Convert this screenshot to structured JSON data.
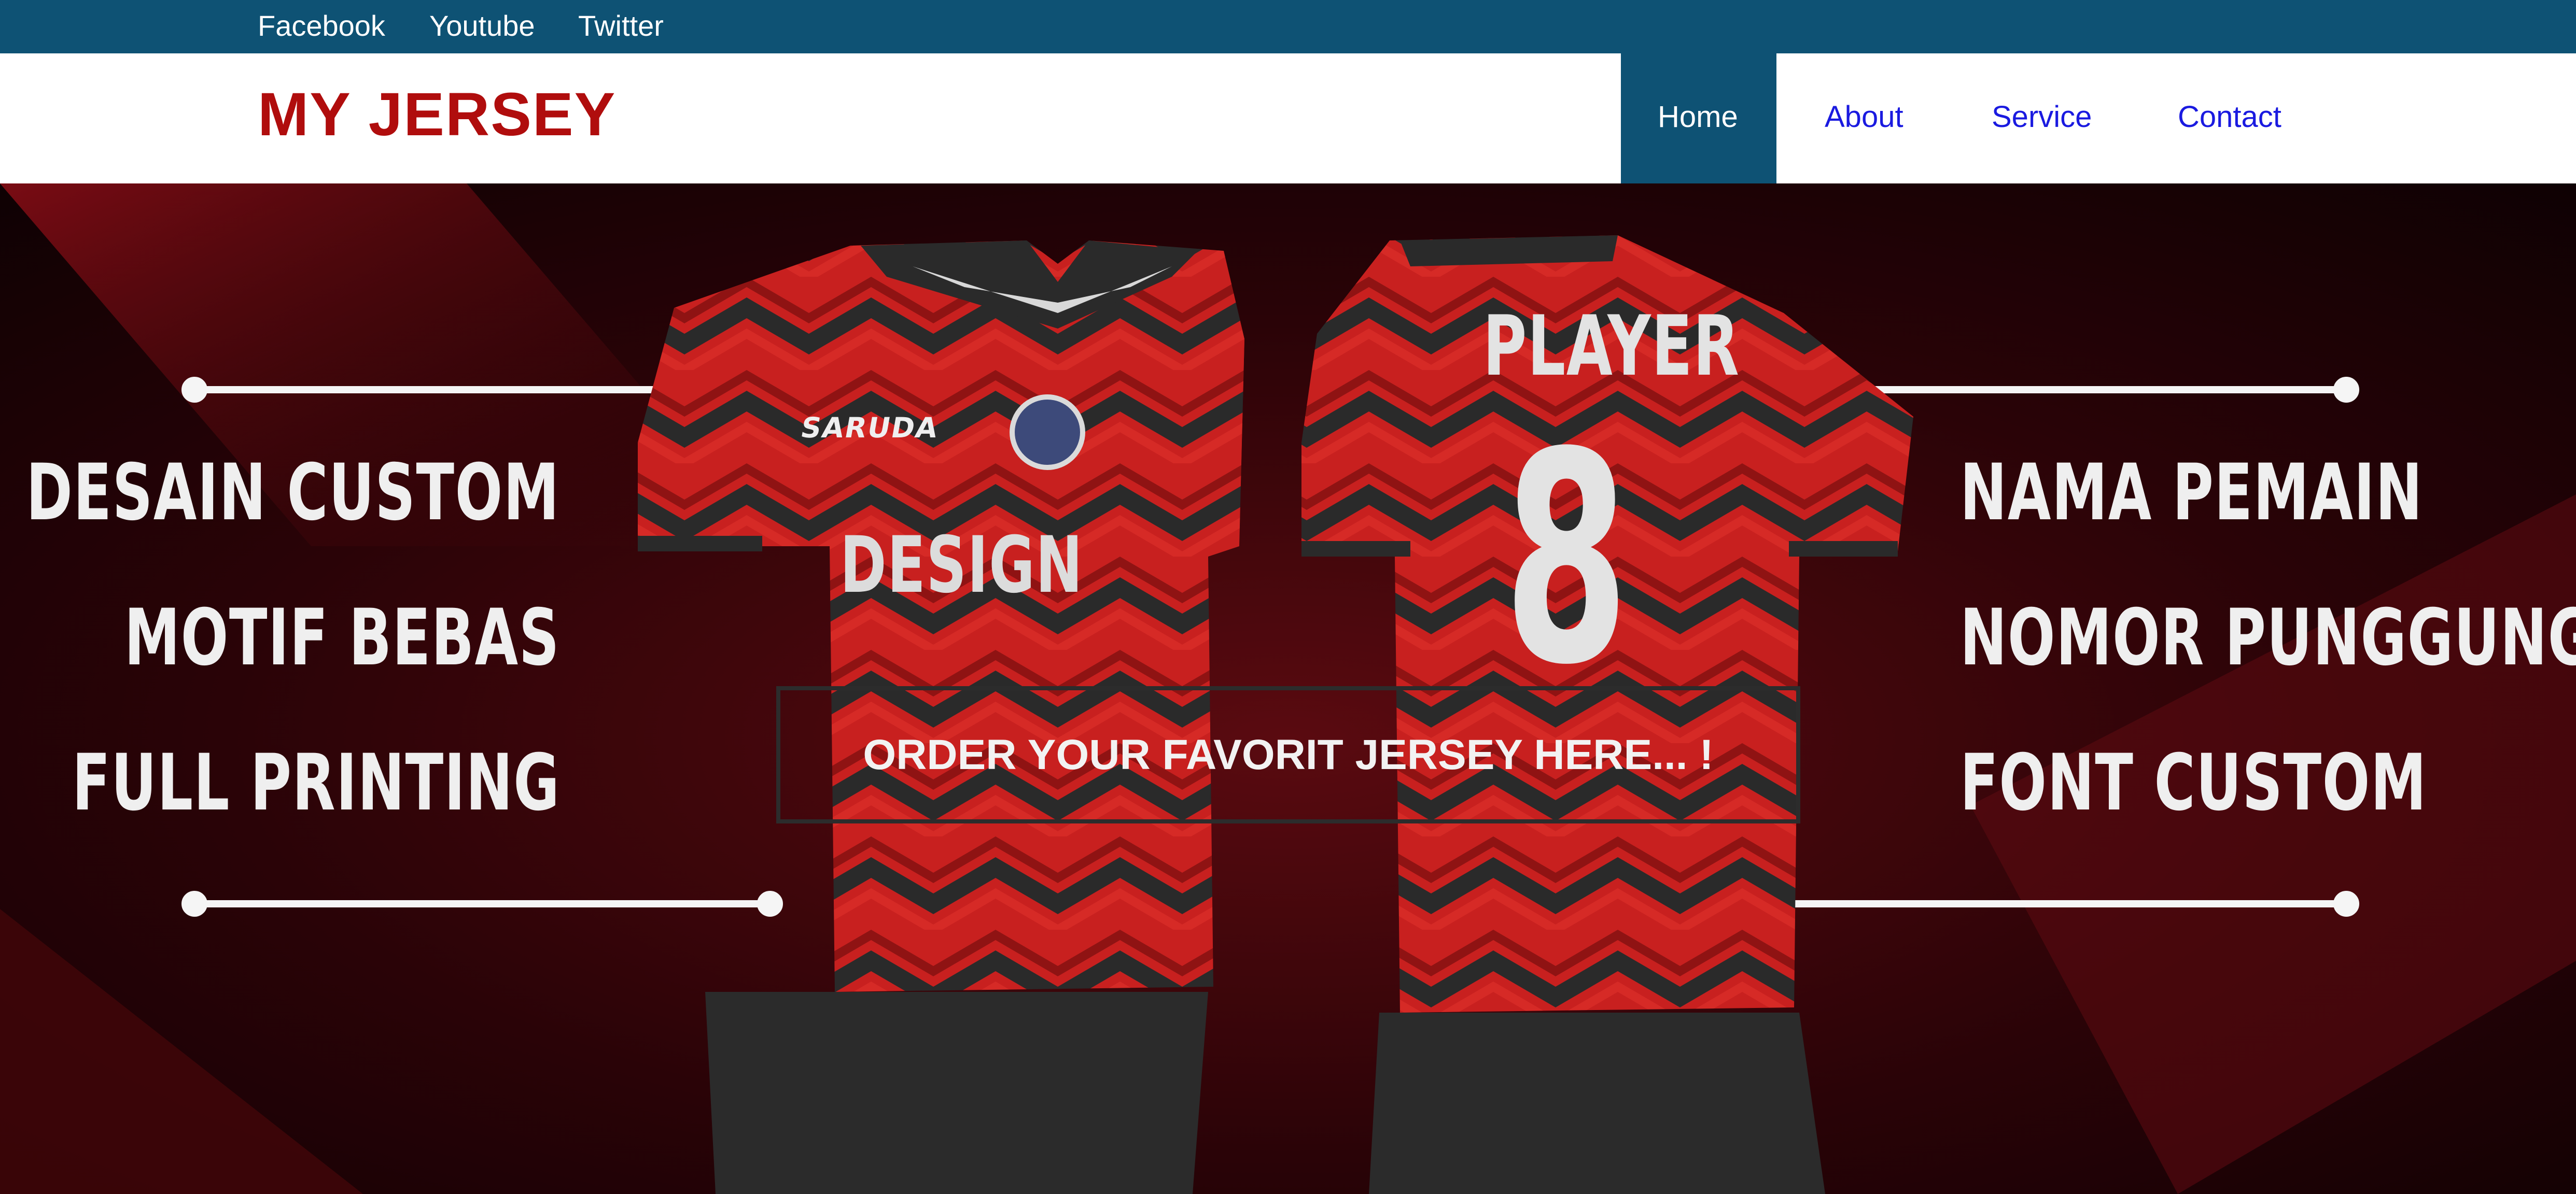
{
  "topbar": {
    "links": [
      {
        "label": "Facebook"
      },
      {
        "label": "Youtube"
      },
      {
        "label": "Twitter"
      }
    ]
  },
  "header": {
    "logo": "MY JERSEY",
    "nav": [
      {
        "label": "Home",
        "active": true
      },
      {
        "label": "About",
        "active": false
      },
      {
        "label": "Service",
        "active": false
      },
      {
        "label": "Contact",
        "active": false
      }
    ]
  },
  "hero": {
    "left_features": [
      "DESAIN CUSTOM",
      "MOTIF BEBAS",
      "FULL PRINTING"
    ],
    "right_features": [
      "NAMA PEMAIN",
      "NOMOR PUNGGUNG",
      "FONT CUSTOM"
    ],
    "jersey_front_brand": "SARUDA",
    "jersey_front_text": "DESIGN",
    "jersey_back_name": "PLAYER",
    "jersey_back_number": "8",
    "cta": "ORDER YOUR FAVORIT JERSEY HERE... !"
  },
  "colors": {
    "topbar": "#0e5274",
    "logo": "#b00d0d",
    "nav_link": "#1a1ae0",
    "nav_active_bg": "#0e5274",
    "jersey_red": "#c8201f",
    "jersey_dark": "#2a2a2a"
  }
}
